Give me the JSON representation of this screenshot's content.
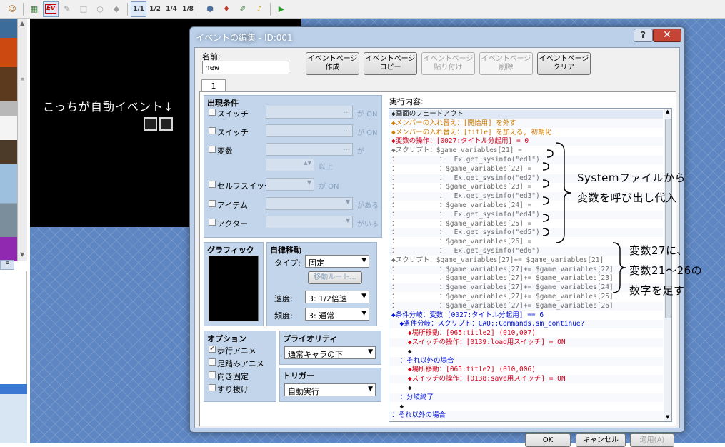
{
  "toolbar": {
    "ev_label": "Ev",
    "zoom_1_1": "1/1",
    "zoom_1_2": "1/2",
    "zoom_1_4": "1/4",
    "zoom_1_8": "1/8",
    "play_icon": "▶"
  },
  "map": {
    "annotation": "こっちが自動イベント↓"
  },
  "tileset": {
    "tab_label": "E"
  },
  "dialog": {
    "title": "イベントの編集 - ID:001",
    "help_label": "?",
    "close_label": "✕",
    "name_label": "名前:",
    "name_value": "new",
    "page_buttons": [
      {
        "line1": "イベントページ",
        "line2": "作成"
      },
      {
        "line1": "イベントページ",
        "line2": "コピー"
      },
      {
        "line1": "イベントページ",
        "line2": "貼り付け"
      },
      {
        "line1": "イベントページ",
        "line2": "削除"
      },
      {
        "line1": "イベントページ",
        "line2": "クリア"
      }
    ],
    "tab_label": "1",
    "conditions": {
      "title": "出現条件",
      "switch1": "スイッチ",
      "switch2": "スイッチ",
      "variable": "変数",
      "self_switch": "セルフスイッチ",
      "item": "アイテム",
      "actor": "アクター",
      "suffix_on": "が ON",
      "suffix_ga": "が",
      "suffix_ijou": "以上",
      "suffix_aru": "がある",
      "suffix_iru": "がいる"
    },
    "graphic": {
      "title": "グラフィック"
    },
    "autonomous": {
      "title": "自律移動",
      "type_label": "タイプ:",
      "type_value": "固定",
      "route_button": "移動ルート...",
      "speed_label": "速度:",
      "speed_value": "3: 1/2倍速",
      "freq_label": "頻度:",
      "freq_value": "3: 通常"
    },
    "options": {
      "title": "オプション",
      "walk_anim": "歩行アニメ",
      "step_anim": "足踏みアニメ",
      "direction_fix": "向き固定",
      "through": "すり抜け"
    },
    "priority": {
      "title": "プライオリティ",
      "value": "通常キャラの下"
    },
    "trigger": {
      "title": "トリガー",
      "value": "自動実行"
    },
    "contents_label": "実行内容:",
    "commands": [
      {
        "text": "◆画面のフェードアウト",
        "color": "dark"
      },
      {
        "text": "◆メンバーの入れ替え：[開始用] を外す",
        "color": "orange"
      },
      {
        "text": "◆メンバーの入れ替え：[title] を加える, 初期化",
        "color": "orange"
      },
      {
        "text": "◆変数の操作：[0027:タイトル分起用] = 0",
        "color": "red"
      },
      {
        "text": "◆スクリプト：$game_variables[21] =",
        "color": "gray"
      },
      {
        "text": "：          ：  Ex.get_sysinfo(\"ed1\")",
        "color": "gray"
      },
      {
        "text": "：          ：$game_variables[22] =",
        "color": "gray"
      },
      {
        "text": "：          ：  Ex.get_sysinfo(\"ed2\")",
        "color": "gray"
      },
      {
        "text": "：          ：$game_variables[23] =",
        "color": "gray"
      },
      {
        "text": "：          ：  Ex.get_sysinfo(\"ed3\")",
        "color": "gray"
      },
      {
        "text": "：          ：$game_variables[24] =",
        "color": "gray"
      },
      {
        "text": "：          ：  Ex.get_sysinfo(\"ed4\")",
        "color": "gray"
      },
      {
        "text": "：          ：$game_variables[25] =",
        "color": "gray"
      },
      {
        "text": "：          ：  Ex.get_sysinfo(\"ed5\")",
        "color": "gray"
      },
      {
        "text": "：          ：$game_variables[26] =",
        "color": "gray"
      },
      {
        "text": "：          ：  Ex.get_sysinfo(\"ed6\")",
        "color": "gray"
      },
      {
        "text": "◆スクリプト：$game_variables[27]+= $game_variables[21]",
        "color": "gray"
      },
      {
        "text": "：          ：$game_variables[27]+= $game_variables[22]",
        "color": "gray"
      },
      {
        "text": "：          ：$game_variables[27]+= $game_variables[23]",
        "color": "gray"
      },
      {
        "text": "：          ：$game_variables[27]+= $game_variables[24]",
        "color": "gray"
      },
      {
        "text": "：          ：$game_variables[27]+= $game_variables[25]",
        "color": "gray"
      },
      {
        "text": "：          ：$game_variables[27]+= $game_variables[26]",
        "color": "gray"
      },
      {
        "text": "◆条件分岐：変数 [0027:タイトル分起用] == 6",
        "color": "blue"
      },
      {
        "text": "  ◆条件分岐：スクリプト：CAO::Commands.sm_continue?",
        "color": "blue"
      },
      {
        "text": "    ◆場所移動：[065:title2] (010,007)",
        "color": "red"
      },
      {
        "text": "    ◆スイッチの操作：[0139:load用スイッチ] = ON",
        "color": "red"
      },
      {
        "text": "    ◆",
        "color": "dark"
      },
      {
        "text": "  ：それ以外の場合",
        "color": "blue"
      },
      {
        "text": "    ◆場所移動：[065:title2] (010,006)",
        "color": "red"
      },
      {
        "text": "    ◆スイッチの操作：[0138:save用スイッチ] = ON",
        "color": "red"
      },
      {
        "text": "    ◆",
        "color": "dark"
      },
      {
        "text": "  ：分岐終了",
        "color": "blue"
      },
      {
        "text": "  ◆",
        "color": "dark"
      },
      {
        "text": "：それ以外の場合",
        "color": "blue"
      }
    ],
    "ok_label": "OK",
    "cancel_label": "キャンセル",
    "apply_label": "適用(A)"
  },
  "annotations": {
    "system_line1": "Systemファイルから",
    "system_line2": "変数を呼び出し代入",
    "sum_line1": "変数27に、",
    "sum_line2": "変数21〜26の",
    "sum_line3": "数字を足す"
  }
}
